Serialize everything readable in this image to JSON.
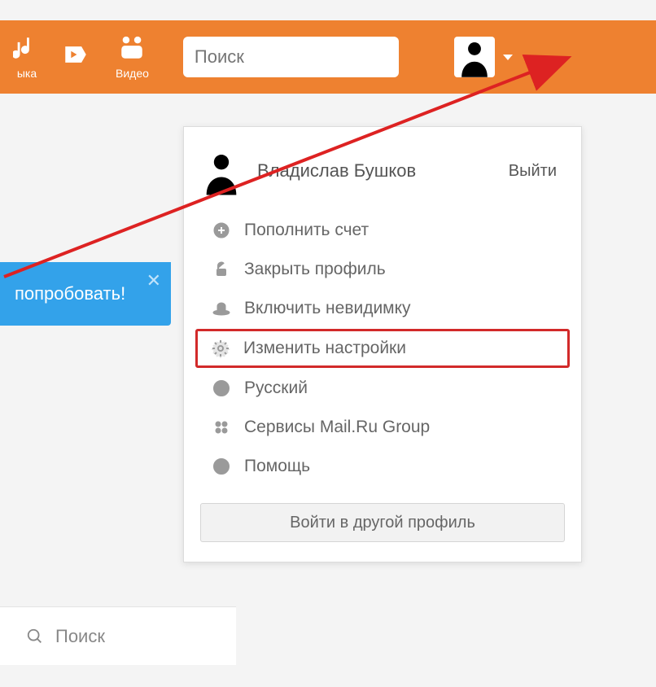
{
  "topbar": {
    "nav": [
      {
        "label": "ыка"
      },
      {
        "label": ""
      },
      {
        "label": "Видео"
      }
    ],
    "search_placeholder": "Поиск"
  },
  "dropdown": {
    "user_name": "Владислав Бушков",
    "logout": "Выйти",
    "items": [
      {
        "label": "Пополнить счет"
      },
      {
        "label": "Закрыть профиль"
      },
      {
        "label": "Включить невидимку"
      },
      {
        "label": "Изменить настройки"
      },
      {
        "label": "Русский"
      },
      {
        "label": "Сервисы Mail.Ru Group"
      },
      {
        "label": "Помощь"
      }
    ],
    "footer_button": "Войти в другой профиль"
  },
  "promo": {
    "text": "попробовать!"
  },
  "bottom_search": {
    "label": "Поиск"
  }
}
